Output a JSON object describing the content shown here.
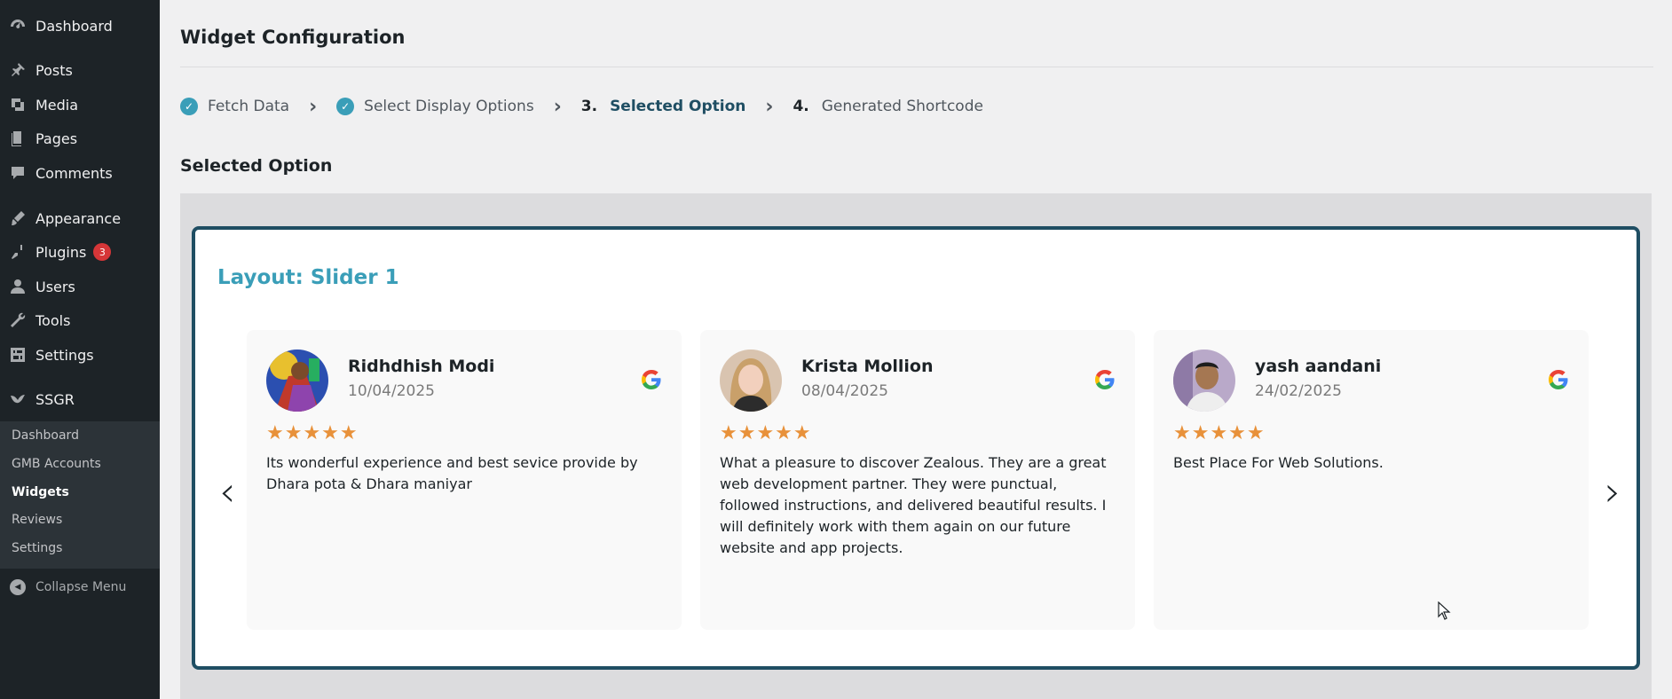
{
  "sidebar": {
    "items": [
      {
        "label": "Dashboard",
        "icon": "dashboard-icon"
      },
      {
        "label": "Posts",
        "icon": "pin-icon"
      },
      {
        "label": "Media",
        "icon": "media-icon"
      },
      {
        "label": "Pages",
        "icon": "pages-icon"
      },
      {
        "label": "Comments",
        "icon": "comment-icon"
      },
      {
        "label": "Appearance",
        "icon": "paintbrush-icon"
      },
      {
        "label": "Plugins",
        "icon": "plugin-icon",
        "badge": "3"
      },
      {
        "label": "Users",
        "icon": "user-icon"
      },
      {
        "label": "Tools",
        "icon": "wrench-icon"
      },
      {
        "label": "Settings",
        "icon": "settings-icon"
      },
      {
        "label": "SSGR",
        "icon": "bird-icon"
      }
    ],
    "submenu": [
      "Dashboard",
      "GMB Accounts",
      "Widgets",
      "Reviews",
      "Settings"
    ],
    "collapse_label": "Collapse Menu"
  },
  "page": {
    "title": "Widget Configuration",
    "section_title": "Selected Option"
  },
  "steps": [
    {
      "num": "",
      "label": "Fetch Data",
      "status": "done"
    },
    {
      "num": "",
      "label": "Select Display Options",
      "status": "done"
    },
    {
      "num": "3.",
      "label": "Selected Option",
      "status": "current"
    },
    {
      "num": "4.",
      "label": "Generated Shortcode",
      "status": "pending"
    }
  ],
  "widget": {
    "layout_title": "Layout: Slider 1",
    "prev_glyph": "‹",
    "next_glyph": "›",
    "reviews": [
      {
        "name": "Ridhdhish Modi",
        "date": "10/04/2025",
        "stars": "★★★★★",
        "text": "Its wonderful experience and best sevice provide by Dhara pota & Dhara maniyar"
      },
      {
        "name": "Krista Mollion",
        "date": "08/04/2025",
        "stars": "★★★★★",
        "text": "What a pleasure to discover Zealous. They are a great web development partner. They were punctual, followed instructions, and delivered beautiful results. I will definitely work with them again on our future website and app projects."
      },
      {
        "name": "yash aandani",
        "date": "24/02/2025",
        "stars": "★★★★★",
        "text": "Best Place For Web Solutions."
      }
    ]
  },
  "colors": {
    "accent": "#3a9eb8",
    "border": "#1f4e63",
    "star": "#e8913a",
    "sidebar_bg": "#1d2327",
    "badge": "#d63638"
  }
}
